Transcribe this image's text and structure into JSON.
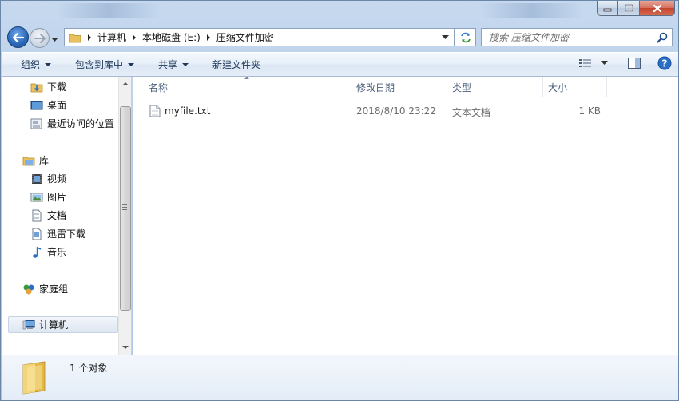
{
  "window": {
    "caption": {
      "minimize": "minimize",
      "maximize": "maximize",
      "close": "close"
    }
  },
  "address": {
    "crumbs": [
      "计算机",
      "本地磁盘 (E:)",
      "压缩文件加密"
    ]
  },
  "search": {
    "placeholder": "搜索 压缩文件加密"
  },
  "toolbar": {
    "organize": "组织",
    "include_in_library": "包含到库中",
    "share": "共享",
    "new_folder": "新建文件夹"
  },
  "nav": {
    "downloads": "下载",
    "desktop": "桌面",
    "recent": "最近访问的位置",
    "libraries": "库",
    "videos": "视频",
    "pictures": "图片",
    "documents": "文档",
    "thunder": "迅雷下载",
    "music": "音乐",
    "homegroup": "家庭组",
    "computer": "计算机"
  },
  "columns": {
    "name": "名称",
    "modified": "修改日期",
    "type": "类型",
    "size": "大小"
  },
  "files": [
    {
      "name": "myfile.txt",
      "modified": "2018/8/10 23:22",
      "type": "文本文档",
      "size": "1 KB"
    }
  ],
  "details": {
    "count": "1 个对象"
  },
  "colors": {
    "accent": "#1e395b",
    "selection": "#dde6f1",
    "title_gradient": "#b4cbe6"
  }
}
